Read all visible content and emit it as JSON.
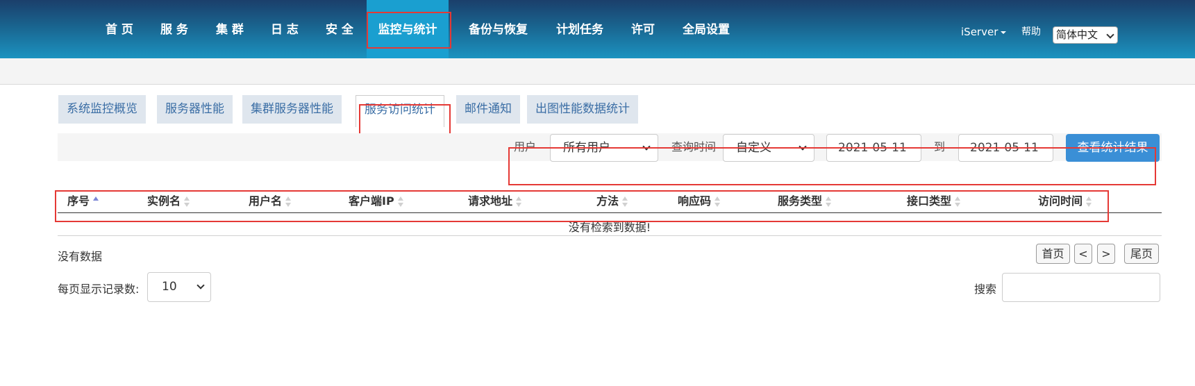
{
  "nav": {
    "items": [
      "首 页",
      "服 务",
      "集 群",
      "日 志",
      "安 全",
      "监控与统计",
      "备份与恢复",
      "计划任务",
      "许可",
      "全局设置"
    ],
    "product": "iServer",
    "help": "帮助",
    "language": "简体中文"
  },
  "tabs": [
    "系统监控概览",
    "服务器性能",
    "集群服务器性能",
    "服务访问统计",
    "邮件通知",
    "出图性能数据统计"
  ],
  "filter": {
    "user_label": "用户",
    "user_value": "所有用户",
    "time_label": "查询时间",
    "time_value": "自定义",
    "start_date": "2021-05-11",
    "to_label": "到",
    "end_date": "2021-05-11",
    "submit_label": "查看统计结果"
  },
  "table": {
    "columns": [
      "序号",
      "实例名",
      "用户名",
      "客户端IP",
      "请求地址",
      "方法",
      "响应码",
      "服务类型",
      "接口类型",
      "访问时间"
    ],
    "empty_message": "没有检索到数据!"
  },
  "footer": {
    "no_data": "没有数据",
    "first": "首页",
    "prev": "<",
    "next": ">",
    "last": "尾页",
    "page_size_label": "每页显示记录数:",
    "page_size": "10",
    "search_label": "搜索"
  },
  "colors": {
    "accent": "#1a9fd0",
    "highlight": "#e53935",
    "primary_button": "#3a8fd6"
  }
}
